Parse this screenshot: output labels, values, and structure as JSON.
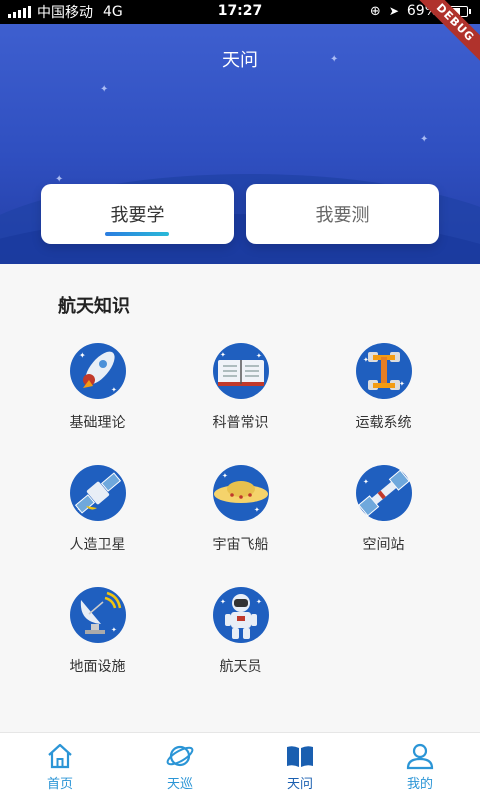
{
  "status_bar": {
    "carrier": "中国移动",
    "network": "4G",
    "time": "17:27",
    "battery_text": "69%",
    "battery_level": 0.69
  },
  "debug_banner": "DEBUG",
  "header": {
    "title": "天问",
    "tabs": [
      {
        "label": "我要学",
        "active": true
      },
      {
        "label": "我要测",
        "active": false
      }
    ]
  },
  "section": {
    "title": "航天知识",
    "items": [
      {
        "label": "基础理论",
        "icon": "rocket-icon"
      },
      {
        "label": "科普常识",
        "icon": "book-icon"
      },
      {
        "label": "运载系统",
        "icon": "launch-tower-icon"
      },
      {
        "label": "人造卫星",
        "icon": "satellite-icon"
      },
      {
        "label": "宇宙飞船",
        "icon": "spaceship-icon"
      },
      {
        "label": "空间站",
        "icon": "space-station-icon"
      },
      {
        "label": "地面设施",
        "icon": "radar-dish-icon"
      },
      {
        "label": "航天员",
        "icon": "astronaut-icon"
      }
    ]
  },
  "bottom_nav": {
    "items": [
      {
        "label": "首页",
        "icon": "home-icon",
        "active": false
      },
      {
        "label": "天巡",
        "icon": "planet-icon",
        "active": false
      },
      {
        "label": "天问",
        "icon": "open-book-icon",
        "active": true
      },
      {
        "label": "我的",
        "icon": "user-icon",
        "active": false
      }
    ]
  },
  "colors": {
    "header_blue": "#3e5fcf",
    "accent": "#2b95d6",
    "icon_circle": "#1f5fbf"
  }
}
